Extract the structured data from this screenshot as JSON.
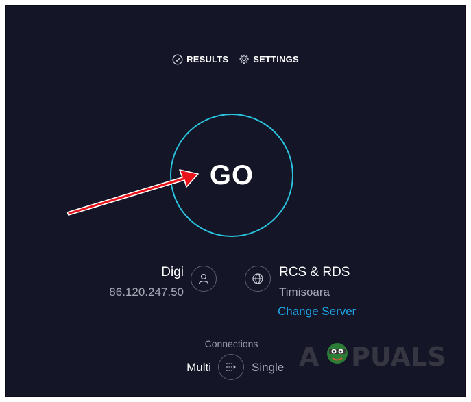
{
  "nav": {
    "results_label": "RESULTS",
    "settings_label": "SETTINGS"
  },
  "go_button": {
    "label": "GO"
  },
  "isp": {
    "name": "Digi",
    "ip": "86.120.247.50"
  },
  "server": {
    "name": "RCS & RDS",
    "location": "Timisoara",
    "change_label": "Change Server"
  },
  "connections": {
    "label": "Connections",
    "multi_label": "Multi",
    "single_label": "Single"
  },
  "watermark": {
    "text": "APPUALS"
  },
  "colors": {
    "background": "#141526",
    "accent_ring": "#2bc4e0",
    "link": "#1ea7e8",
    "annotation_arrow": "#e8141a"
  }
}
